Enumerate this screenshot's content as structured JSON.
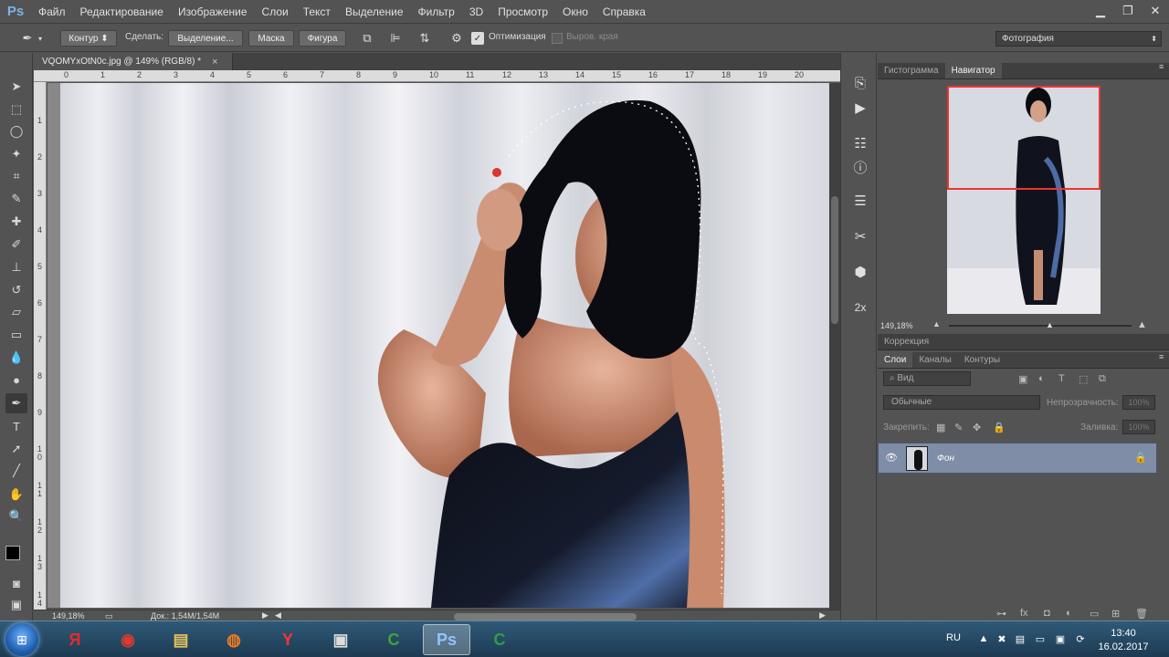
{
  "app": {
    "logo": "Ps"
  },
  "menu": [
    "Файл",
    "Редактирование",
    "Изображение",
    "Слои",
    "Текст",
    "Выделение",
    "Фильтр",
    "3D",
    "Просмотр",
    "Окно",
    "Справка"
  ],
  "window_controls": {
    "minimize": "▁",
    "restore": "❐",
    "close": "✕"
  },
  "options": {
    "mode": "Контур",
    "make_label": "Сделать:",
    "selection": "Выделение...",
    "mask": "Маска",
    "shape": "Фигура",
    "optimization": "Оптимизация",
    "align_edges": "Выров. края",
    "workspace": "Фотография"
  },
  "document": {
    "tab_title": "VQOMYxOtN0c.jpg @ 149% (RGB/8) *",
    "close": "×"
  },
  "ruler_top": [
    "0",
    "1",
    "2",
    "3",
    "4",
    "5",
    "6",
    "7",
    "8",
    "9",
    "10",
    "11",
    "12",
    "13",
    "14",
    "15",
    "16",
    "17",
    "18",
    "19",
    "20"
  ],
  "ruler_left": [
    "1",
    "2",
    "3",
    "4",
    "5",
    "6",
    "7",
    "8",
    "9",
    "1\n0",
    "1\n1",
    "1\n2",
    "1\n3",
    "1\n4"
  ],
  "status": {
    "zoom": "149,18%",
    "doc": "Док.: 1,54M/1,54M"
  },
  "panels": {
    "top_tabs": [
      "Гистограмма",
      "Навигатор"
    ],
    "nav_zoom": "149,18%",
    "correction": "Коррекция",
    "layer_tabs": [
      "Слои",
      "Каналы",
      "Контуры"
    ],
    "kind": "Вид",
    "blend_mode": "Обычные",
    "opacity_label": "Непрозрачность:",
    "opacity_value": "100%",
    "lock_label": "Закрепить:",
    "fill_label": "Заливка:",
    "fill_value": "100%",
    "layer_name": "Фон"
  },
  "taskbar": {
    "language": "RU",
    "time": "13:40",
    "date": "16.02.2017",
    "apps": [
      {
        "label": "Я",
        "color": "#e7292b"
      },
      {
        "label": "◉",
        "color": "#dd3b2c"
      },
      {
        "label": "▤",
        "color": "#e8c55a"
      },
      {
        "label": "◍",
        "color": "#f07a1e"
      },
      {
        "label": "Y",
        "color": "#ff3333"
      },
      {
        "label": "▣",
        "color": "#dddddd"
      },
      {
        "label": "C",
        "color": "#3ea33e"
      },
      {
        "label": "Ps",
        "color": "#8fc3ff"
      },
      {
        "label": "C",
        "color": "#2e9e45"
      }
    ]
  }
}
